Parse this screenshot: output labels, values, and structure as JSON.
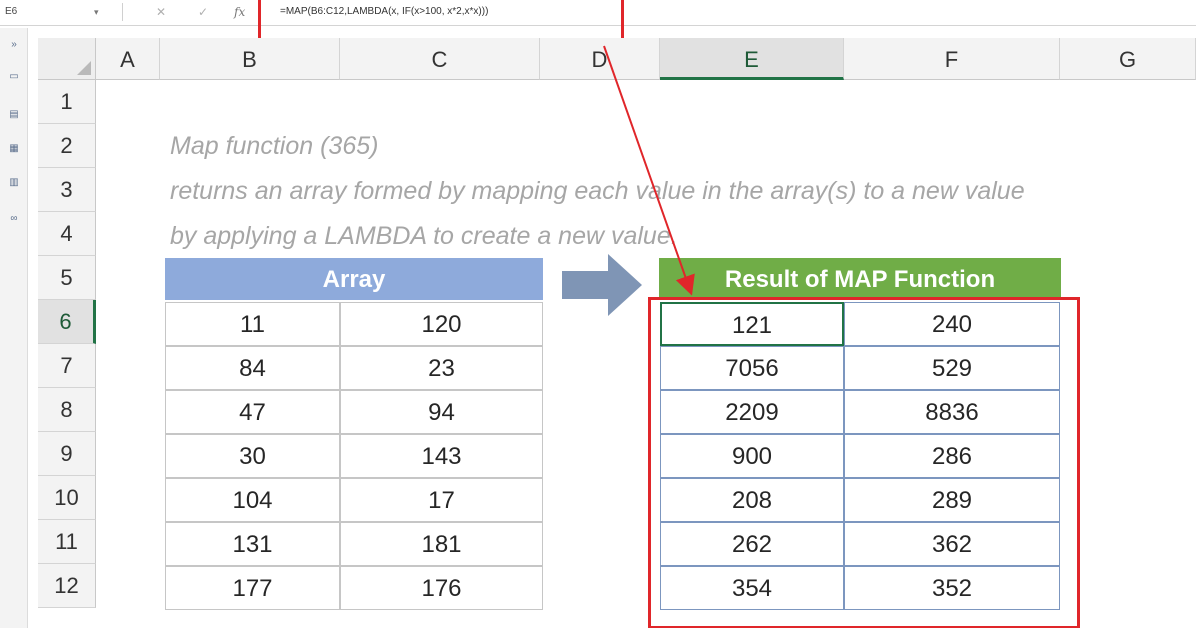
{
  "formula_bar": {
    "name_box": "E6",
    "formula": "=MAP(B6:C12,LAMBDA(x, IF(x>100, x*2,x*x)))",
    "fx_label": "fx"
  },
  "columns": [
    "A",
    "B",
    "C",
    "D",
    "E",
    "F",
    "G"
  ],
  "rows": [
    "1",
    "2",
    "3",
    "4",
    "5",
    "6",
    "7",
    "8",
    "9",
    "10",
    "11",
    "12"
  ],
  "description": {
    "line1": "Map function (365)",
    "line2": "returns an array formed by mapping each value in the array(s) to a new value",
    "line3": "by applying a LAMBDA to create a new value."
  },
  "array_table": {
    "header": "Array",
    "rows": [
      [
        "11",
        "120"
      ],
      [
        "84",
        "23"
      ],
      [
        "47",
        "94"
      ],
      [
        "30",
        "143"
      ],
      [
        "104",
        "17"
      ],
      [
        "131",
        "181"
      ],
      [
        "177",
        "176"
      ]
    ]
  },
  "result_table": {
    "header": "Result of MAP Function",
    "rows": [
      [
        "121",
        "240"
      ],
      [
        "7056",
        "529"
      ],
      [
        "2209",
        "8836"
      ],
      [
        "900",
        "286"
      ],
      [
        "208",
        "289"
      ],
      [
        "262",
        "362"
      ],
      [
        "354",
        "352"
      ]
    ]
  },
  "colors": {
    "highlight_red": "#e0262a",
    "array_header": "#8eaadb",
    "result_header": "#70ad47",
    "excel_green": "#217346",
    "arrow_gray": "#7f95b5"
  }
}
